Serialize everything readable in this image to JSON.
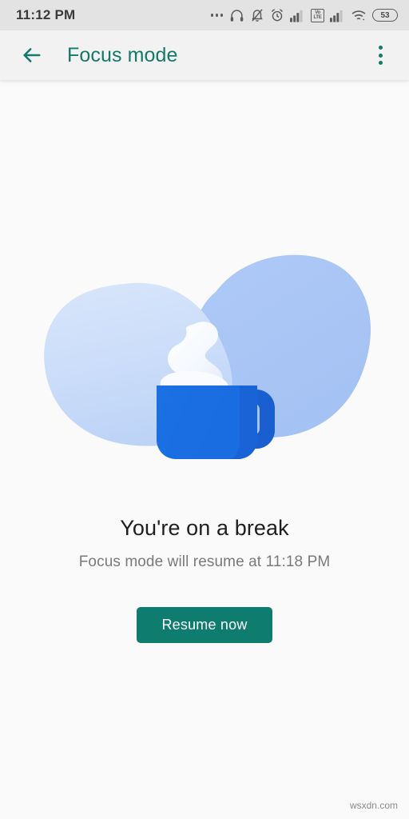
{
  "status_bar": {
    "time": "11:12 PM",
    "battery_level": "53",
    "volte_top": "Vo",
    "volte_bottom": "LTE",
    "icons": [
      "more-dots-icon",
      "headphones-icon",
      "bell-muted-icon",
      "alarm-clock-icon",
      "signal-bars-icon",
      "volte-icon",
      "signal-bars-2-icon",
      "wifi-icon",
      "battery-icon"
    ]
  },
  "app_bar": {
    "back_label": "Back",
    "title": "Focus mode",
    "overflow_label": "More options"
  },
  "main": {
    "illustration_name": "coffee-mug-break-illustration",
    "headline": "You're on a break",
    "subtext": "Focus mode will resume at 11:18 PM",
    "resume_button": "Resume now"
  },
  "watermark": "wsxdn.com",
  "colors": {
    "accent_teal": "#0e7d70",
    "title_teal": "#13796a",
    "status_bar_bg": "#e3e3e3",
    "app_bar_bg": "#f2f2f2",
    "page_bg": "#fafafa",
    "mug_blue": "#1a6fe0",
    "mug_handle_blue": "#1a5fd0",
    "blob_light": "#cddef9",
    "blob_medium": "#a9c6f5",
    "steam_white": "#f7f9fe",
    "headline_color": "#1f1f1f",
    "subtext_color": "#7a7a7a"
  }
}
